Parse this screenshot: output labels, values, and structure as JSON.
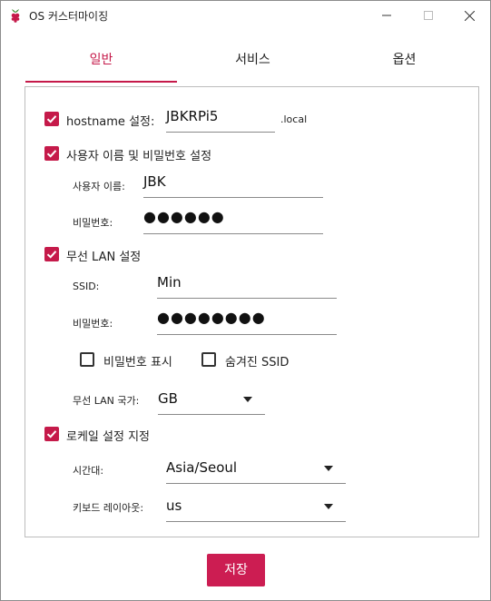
{
  "window": {
    "title": "OS 커스터마이징"
  },
  "tabs": [
    {
      "label": "일반"
    },
    {
      "label": "서비스"
    },
    {
      "label": "옵션"
    }
  ],
  "hostname": {
    "checkbox_label": "hostname 설정:",
    "value": "JBKRPi5",
    "suffix": ".local",
    "checked": true
  },
  "user": {
    "checkbox_label": "사용자 이름 및 비밀번호 설정",
    "checked": true,
    "username_label": "사용자 이름:",
    "username_value": "JBK",
    "password_label": "비밀번호:",
    "password_value": "●●●●●●"
  },
  "wlan": {
    "checkbox_label": "무선 LAN 설정",
    "checked": true,
    "ssid_label": "SSID:",
    "ssid_value": "Min",
    "password_label": "비밀번호:",
    "password_value": "●●●●●●●●",
    "show_password_label": "비밀번호 표시",
    "show_password_checked": false,
    "hidden_ssid_label": "숨겨진 SSID",
    "hidden_ssid_checked": false,
    "country_label": "무선 LAN 국가:",
    "country_value": "GB"
  },
  "locale": {
    "checkbox_label": "로케일 설정 지정",
    "checked": true,
    "timezone_label": "시간대:",
    "timezone_value": "Asia/Seoul",
    "keyboard_label": "키보드 레이아웃:",
    "keyboard_value": "us"
  },
  "save_label": "저장",
  "accent": "#c51a4a"
}
